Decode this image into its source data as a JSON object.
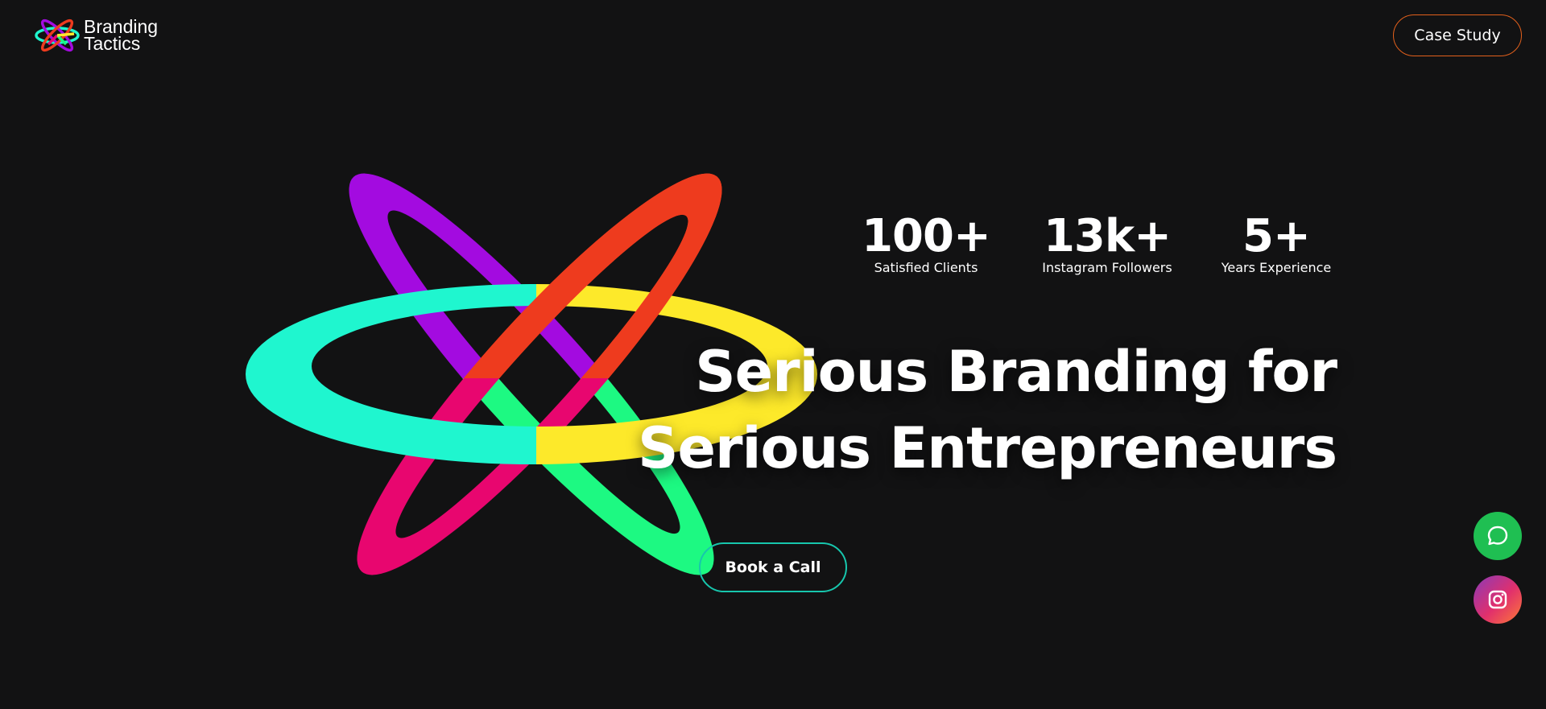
{
  "brand": {
    "line1": "Branding",
    "line2": "Tactics"
  },
  "header": {
    "case_study_label": "Case Study"
  },
  "stats": [
    {
      "value": "100+",
      "label": "Satisfied Clients"
    },
    {
      "value": "13k+",
      "label": "Instagram Followers"
    },
    {
      "value": "5+",
      "label": "Years Experience"
    }
  ],
  "hero": {
    "headline_line1": "Serious Branding for",
    "headline_line2": "Serious Entrepreneurs",
    "cta_label": "Book a Call"
  },
  "floating": {
    "chat_icon": "chat-bubble-icon",
    "instagram_icon": "instagram-icon"
  },
  "colors": {
    "background": "#121213",
    "purple": "#a30be0",
    "red": "#ee3b1e",
    "cyan": "#1ff6cf",
    "yellow": "#fde92a",
    "magenta": "#e8066f",
    "green": "#1df982",
    "case_study_border": "#e2601c",
    "cta_border": "#17c6ad",
    "chat_bg": "#1fbf52"
  }
}
